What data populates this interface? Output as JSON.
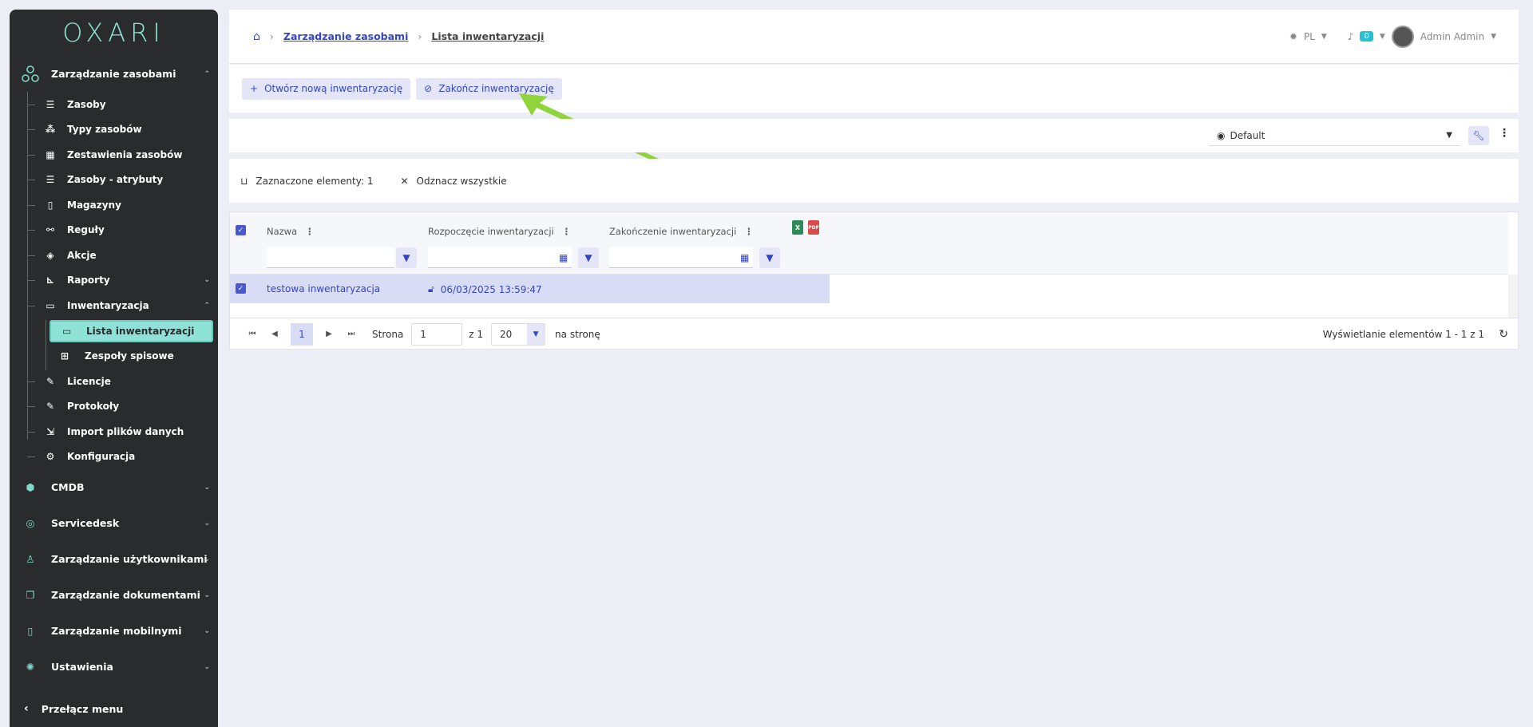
{
  "sidebar": {
    "logo": "OXARI",
    "top_section": "Zarządzanie zasobami",
    "items": [
      {
        "label": "Zasoby",
        "icon": "list-icon"
      },
      {
        "label": "Typy zasobów",
        "icon": "nodes-icon"
      },
      {
        "label": "Zestawienia zasobów",
        "icon": "table-icon"
      },
      {
        "label": "Zasoby - atrybuty",
        "icon": "list-icon"
      },
      {
        "label": "Magazyny",
        "icon": "building-icon"
      },
      {
        "label": "Reguły",
        "icon": "flow-icon"
      },
      {
        "label": "Akcje",
        "icon": "diamond-icon"
      },
      {
        "label": "Raporty",
        "icon": "chart-icon"
      },
      {
        "label": "Inwentaryzacja",
        "icon": "box-icon"
      },
      {
        "label": "Licencje",
        "icon": "license-icon"
      },
      {
        "label": "Protokoły",
        "icon": "protocol-icon"
      },
      {
        "label": "Import plików danych",
        "icon": "import-icon"
      },
      {
        "label": "Konfiguracja",
        "icon": "gears-icon"
      }
    ],
    "inv_sub": [
      {
        "label": "Lista inwentaryzacji"
      },
      {
        "label": "Zespoły spisowe"
      }
    ],
    "sections": [
      {
        "label": "CMDB"
      },
      {
        "label": "Servicedesk"
      },
      {
        "label": "Zarządzanie użytkownikami"
      },
      {
        "label": "Zarządzanie dokumentami"
      },
      {
        "label": "Zarządzanie mobilnymi"
      },
      {
        "label": "Ustawienia"
      }
    ],
    "toggle": "Przełącz menu"
  },
  "header": {
    "crumb1": "Zarządzanie zasobami",
    "crumb2": "Lista inwentaryzacji",
    "lang": "PL",
    "notif_count": "0",
    "user": "Admin Admin"
  },
  "actions": {
    "open_new": "Otwórz nową inwentaryzację",
    "finish": "Zakończ inwentaryzację"
  },
  "view": {
    "selected": "Default"
  },
  "selection": {
    "selected_count": "Zaznaczone elementy: 1",
    "deselect": "Odznacz wszystkie"
  },
  "grid": {
    "columns": [
      "Nazwa",
      "Rozpoczęcie inwentaryzacji",
      "Zakończenie inwentaryzacji"
    ],
    "rows": [
      {
        "name": "testowa inwentaryzacja",
        "start": "06/03/2025 13:59:47"
      }
    ],
    "xls_label": "X",
    "pdf_label": "PDF"
  },
  "pager": {
    "current": "1",
    "page_label": "Strona",
    "page_value": "1",
    "of": "z 1",
    "per_page": "20",
    "per_page_label": "na stronę",
    "info": "Wyświetlanie elementów 1 - 1 z 1"
  },
  "colors": {
    "accent": "#3346c4",
    "sidebar_bg": "#2a2b2d",
    "sidebar_active": "#8fe3d6",
    "row_selected": "#d9dcf5",
    "annotation_arrow": "#8fd43a"
  }
}
